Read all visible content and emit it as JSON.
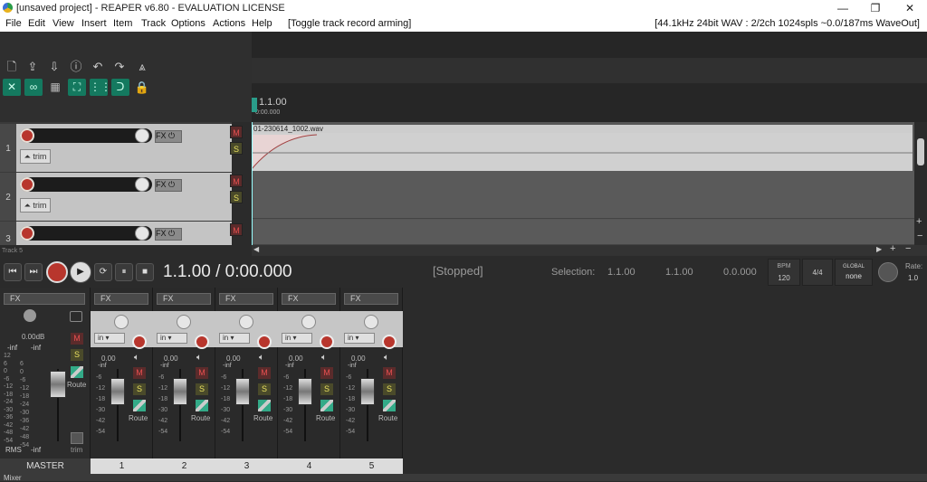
{
  "window": {
    "title": "[unsaved project] - REAPER v6.80 - EVALUATION LICENSE",
    "min": "—",
    "max": "❐",
    "close": "✕"
  },
  "menu": {
    "items": [
      "File",
      "Edit",
      "View",
      "Insert",
      "Item",
      "Track",
      "Options",
      "Actions",
      "Help",
      "[Toggle track record arming]"
    ],
    "status": "[44.1kHz 24bit WAV : 2/2ch 1024spls ~0.0/187ms WaveOut]"
  },
  "ruler": {
    "position": "1.1.00",
    "time": "0:00.000"
  },
  "tracks": [
    {
      "number": "1",
      "fx": "FX",
      "trim": "trim"
    },
    {
      "number": "2",
      "fx": "FX",
      "trim": "trim"
    },
    {
      "number": "3",
      "fx": "FX"
    }
  ],
  "track_buttons": {
    "mute": "M",
    "solo": "S"
  },
  "media_item": {
    "name": "01-230614_1002.wav"
  },
  "track_hint": "Track 5",
  "transport": {
    "time": "1.1.00 / 0:00.000",
    "state": "[Stopped]",
    "selection_label": "Selection:",
    "sel_start": "1.1.00",
    "sel_end": "1.1.00",
    "sel_len": "0.0.000",
    "bpm_label": "BPM",
    "bpm": "120",
    "signature": "4/4",
    "global_label": "GLOBAL",
    "global_value": "none",
    "rate_label": "Rate:",
    "rate": "1.0"
  },
  "master": {
    "fx": "FX",
    "db": "0.00dB",
    "peak_l": "-inf",
    "peak_r": "-inf",
    "rms": "RMS",
    "rms_val": "-inf",
    "mute": "M",
    "solo": "S",
    "route": "Route",
    "trim": "trim",
    "name": "MASTER",
    "scale_l": "12\n6\n0\n-6\n-12\n-18\n-24\n-30\n-36\n-42\n-48\n-54",
    "scale_r": "6\n0\n-6\n-12\n-18\n-24\n-30\n-36\n-42\n-48\n-54"
  },
  "channels": [
    {
      "name": "1",
      "fx": "FX",
      "in": "in",
      "db": "0.00",
      "peak": "-inf",
      "route": "Route",
      "m": "M",
      "s": "S"
    },
    {
      "name": "2",
      "fx": "FX",
      "in": "in",
      "db": "0.00",
      "peak": "-inf",
      "route": "Route",
      "m": "M",
      "s": "S"
    },
    {
      "name": "3",
      "fx": "FX",
      "in": "in",
      "db": "0.00",
      "peak": "-inf",
      "route": "Route",
      "m": "M",
      "s": "S"
    },
    {
      "name": "4",
      "fx": "FX",
      "in": "in",
      "db": "0.00",
      "peak": "-inf",
      "route": "Route",
      "m": "M",
      "s": "S"
    },
    {
      "name": "5",
      "fx": "FX",
      "in": "in",
      "db": "0.00",
      "peak": "-inf",
      "route": "Route",
      "m": "M",
      "s": "S"
    }
  ],
  "channel_scale": "-6\n-12\n-18\n-30\n-42\n-54",
  "mixer_tab": "Mixer"
}
